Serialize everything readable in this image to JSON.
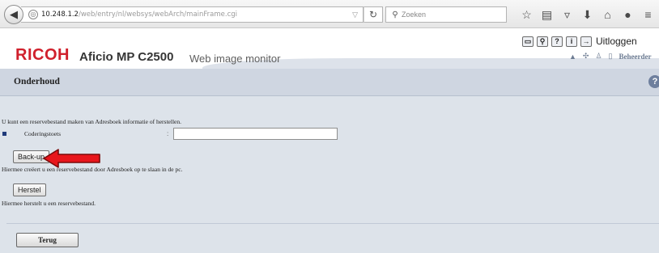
{
  "browser": {
    "url_host": "10.248.1.2",
    "url_path": "/web/entry/nl/websys/webArch/mainFrame.cgi",
    "search_placeholder": "Zoeken",
    "icons": [
      "back-icon",
      "globe-icon",
      "dropdown-icon",
      "reload-icon",
      "search-icon",
      "star-icon",
      "reading-list-icon",
      "pocket-icon",
      "download-icon",
      "home-icon",
      "chat-icon",
      "menu-icon"
    ]
  },
  "header": {
    "brand": "RICOH",
    "model": "Aficio MP C2500",
    "product": "Web image monitor",
    "logout_label": "Uitloggen",
    "user_role": "Beheerder",
    "brand_color": "#d0202c"
  },
  "page": {
    "title": "Onderhoud",
    "description": "U kunt een reservebestand maken van Adresboek informatie of herstellen.",
    "field_label": "Coderingstoets",
    "field_colon": ":",
    "field_value": "",
    "backup_label": "Back-up",
    "backup_note": "Hiermee creëert u een reservebestand door Adresboek op te slaan in de pc.",
    "restore_label": "Herstel",
    "restore_note": "Hiermee herstelt u een reservebestand.",
    "back_label": "Terug",
    "background_color": "#dde3ea"
  }
}
